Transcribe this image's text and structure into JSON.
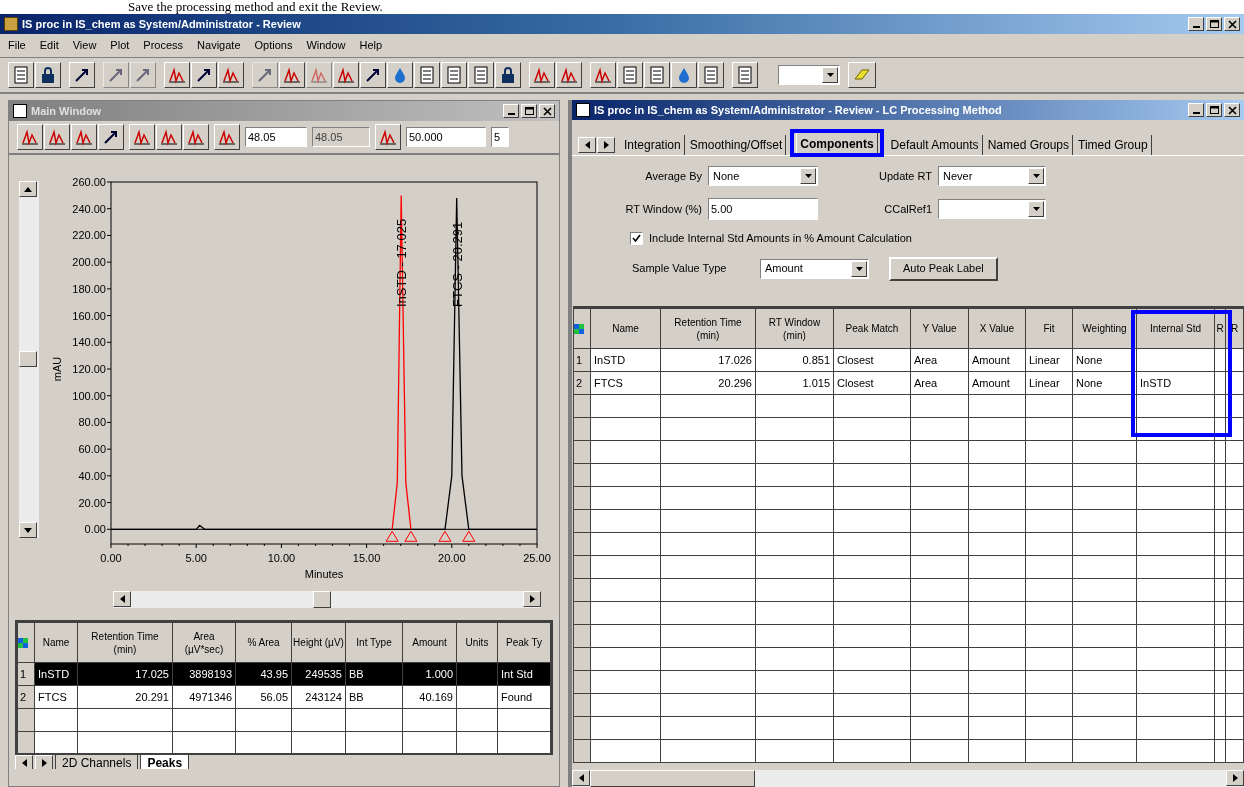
{
  "document_text": "Save the processing method and exit the Review.",
  "window": {
    "title": "IS proc in IS_chem as System/Administrator - Review",
    "menu": [
      "File",
      "Edit",
      "View",
      "Plot",
      "Process",
      "Navigate",
      "Options",
      "Window",
      "Help"
    ]
  },
  "main_window": {
    "title": "Main Window",
    "fields": [
      {
        "value": "48.05",
        "disabled": false
      },
      {
        "value": "48.05",
        "disabled": true
      },
      {
        "value": "50.000",
        "disabled": false
      },
      {
        "value": "5",
        "disabled": false
      }
    ],
    "chart_data": {
      "type": "line",
      "xlabel": "Minutes",
      "ylabel": "mAU",
      "xlim": [
        0,
        25
      ],
      "ylim": [
        -11,
        260
      ],
      "xticks": [
        {
          "value": 0,
          "label": "0.00"
        },
        {
          "value": 5,
          "label": "5.00"
        },
        {
          "value": 10,
          "label": "10.00"
        },
        {
          "value": 15,
          "label": "15.00"
        },
        {
          "value": 20,
          "label": "20.00"
        },
        {
          "value": 25,
          "label": "25.00"
        }
      ],
      "yticks": [
        {
          "value": 0,
          "label": "0.00"
        },
        {
          "value": 20,
          "label": "20.00"
        },
        {
          "value": 40,
          "label": "40.00"
        },
        {
          "value": 60,
          "label": "60.00"
        },
        {
          "value": 80,
          "label": "80.00"
        },
        {
          "value": 100,
          "label": "100.00"
        },
        {
          "value": 120,
          "label": "120.00"
        },
        {
          "value": 140,
          "label": "140.00"
        },
        {
          "value": 160,
          "label": "160.00"
        },
        {
          "value": 180,
          "label": "180.00"
        },
        {
          "value": 200,
          "label": "200.00"
        },
        {
          "value": 220,
          "label": "220.00"
        },
        {
          "value": 240,
          "label": "240.00"
        },
        {
          "value": 260,
          "label": "260.00"
        }
      ],
      "x": [
        0,
        5,
        5.2,
        5.5,
        16.5,
        16.8,
        17.03,
        17.3,
        17.6,
        19.6,
        20.0,
        20.29,
        20.6,
        21,
        25
      ],
      "series": [
        {
          "color": "#000000",
          "values": [
            0,
            0,
            3,
            0,
            0,
            0,
            0,
            0,
            0,
            0,
            40,
            248,
            40,
            0,
            0
          ]
        },
        {
          "color": "#ff0000",
          "values": [
            null,
            null,
            null,
            null,
            0,
            35,
            250,
            35,
            0,
            null,
            null,
            null,
            null,
            null,
            null
          ]
        }
      ],
      "annotations": [
        "InSTD - 17.025",
        "FTCS - 20.291"
      ]
    },
    "peaks_table": {
      "columns": [
        "Name",
        "Retention Time (min)",
        "Area (µV*sec)",
        "% Area",
        "Height (µV)",
        "Int Type",
        "Amount",
        "Units",
        "Peak Ty"
      ],
      "rows": [
        {
          "number": "1",
          "selected": true,
          "cells": [
            "InSTD",
            "17.025",
            "3898193",
            "43.95",
            "249535",
            "BB",
            "1.000",
            null,
            "Int Std"
          ]
        },
        {
          "number": "2",
          "selected": false,
          "cells": [
            "FTCS",
            "20.291",
            "4971346",
            "56.05",
            "243124",
            "BB",
            "40.169",
            null,
            "Found"
          ]
        }
      ]
    },
    "sheet_tabs": [
      {
        "label": "2D Channels",
        "selected": false
      },
      {
        "label": "Peaks",
        "selected": true
      }
    ]
  },
  "method_window": {
    "title": "IS proc in IS_chem as System/Administrator - Review - LC Processing Method",
    "tabs": [
      {
        "label": "Integration",
        "selected": false
      },
      {
        "label": "Smoothing/Offset",
        "selected": false
      },
      {
        "label": "Components",
        "selected": true
      },
      {
        "label": "Default Amounts",
        "selected": false
      },
      {
        "label": "Named Groups",
        "selected": false
      },
      {
        "label": "Timed Group",
        "selected": false
      }
    ],
    "settings": [
      {
        "label": "Average By",
        "value": "None",
        "kind": "dropdown"
      },
      {
        "label": "Update RT",
        "value": "Never",
        "kind": "dropdown"
      },
      {
        "label": "RT Window (%)",
        "value": "5.00",
        "kind": "text"
      },
      {
        "label": "CCalRef1",
        "kind": "dropdown"
      }
    ],
    "include_internal_std": {
      "label": "Include Internal Std Amounts in % Amount Calculation",
      "checked": true
    },
    "sample_value_type": {
      "label": "Sample Value Type",
      "value": "Amount"
    },
    "auto_peak_label_button": "Auto Peak Label",
    "components_table": {
      "columns": [
        "Name",
        "Retention Time (min)",
        "RT Window (min)",
        "Peak Match",
        "Y Value",
        "X Value",
        "Fit",
        "Weighting",
        "Internal Std",
        "R",
        "R"
      ],
      "rows": [
        {
          "number": "1",
          "cells": [
            "InSTD",
            "17.026",
            "0.851",
            "Closest",
            "Area",
            "Amount",
            "Linear",
            "None"
          ]
        },
        {
          "number": "2",
          "cells": [
            "FTCS",
            "20.296",
            "1.015",
            "Closest",
            "Area",
            "Amount",
            "Linear",
            "None",
            "InSTD"
          ]
        }
      ]
    }
  }
}
